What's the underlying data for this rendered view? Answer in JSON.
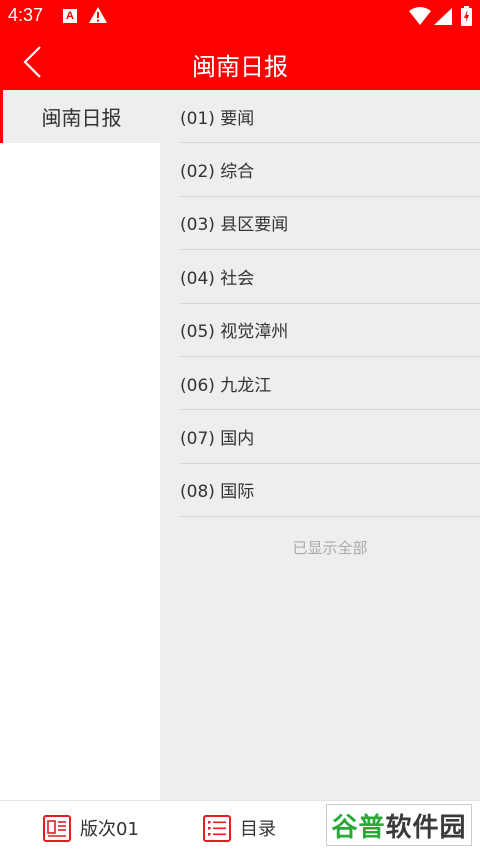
{
  "status_bar": {
    "time": "4:37",
    "icons": [
      "app-a-icon",
      "warning-icon",
      "wifi-icon",
      "signal-icon",
      "battery-icon"
    ]
  },
  "header": {
    "title": "闽南日报",
    "background_color": "#fe0000"
  },
  "sidebar": {
    "items": [
      {
        "label": "闽南日报",
        "selected": true
      }
    ]
  },
  "list": {
    "items": [
      {
        "label": "(01) 要闻"
      },
      {
        "label": "(02) 综合"
      },
      {
        "label": "(03) 县区要闻"
      },
      {
        "label": "(04) 社会"
      },
      {
        "label": "(05) 视觉漳州"
      },
      {
        "label": "(06) 九龙江"
      },
      {
        "label": "(07) 国内"
      },
      {
        "label": "(08) 国际"
      }
    ],
    "footer": "已显示全部"
  },
  "bottom_bar": {
    "edition_label": "版次01",
    "catalog_label": "目录",
    "accent_color": "#e02020"
  },
  "watermark": {
    "text1": "谷普",
    "text2": "软件园"
  }
}
